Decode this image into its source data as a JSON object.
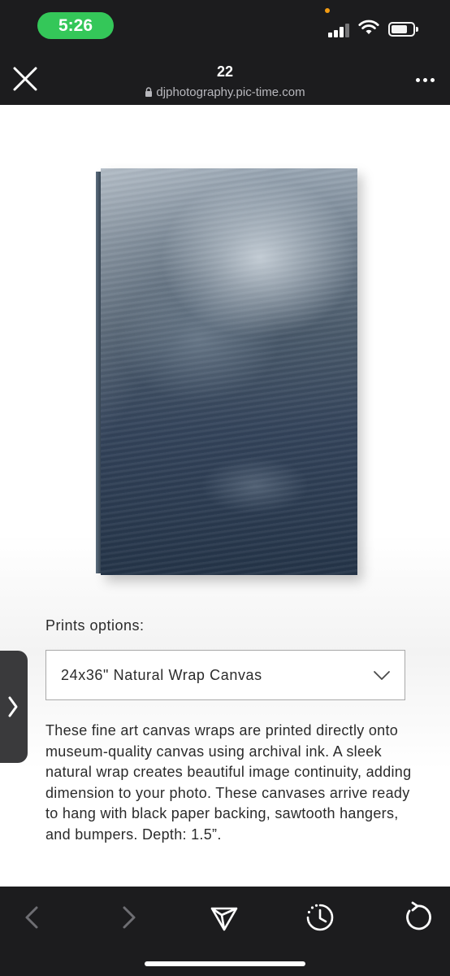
{
  "status_bar": {
    "time": "5:26"
  },
  "browser": {
    "title": "22",
    "url": "djphotography.pic-time.com",
    "close_icon": "close-icon",
    "more_icon": "more-icon",
    "lock_icon": "lock-icon"
  },
  "product": {
    "image_icon": "canvas-print-image",
    "options_label": "Prints options:",
    "selected_option": "24x36\" Natural Wrap Canvas",
    "description": "These fine art canvas wraps are printed directly onto museum-quality canvas using archival ink. A sleek natural wrap creates beautiful image continuity, adding dimension to your photo. These canvases arrive ready to hang with black paper backing, sawtooth hangers, and bumpers. Depth: 1.5”."
  },
  "toolbar": {
    "back_icon": "chevron-left-icon",
    "forward_icon": "chevron-right-icon",
    "share_icon": "send-icon",
    "history_icon": "history-icon",
    "reload_icon": "reload-icon"
  },
  "colors": {
    "status_pill": "#34c759",
    "chrome_bg": "#1c1c1e",
    "text": "#2b2b2b"
  }
}
